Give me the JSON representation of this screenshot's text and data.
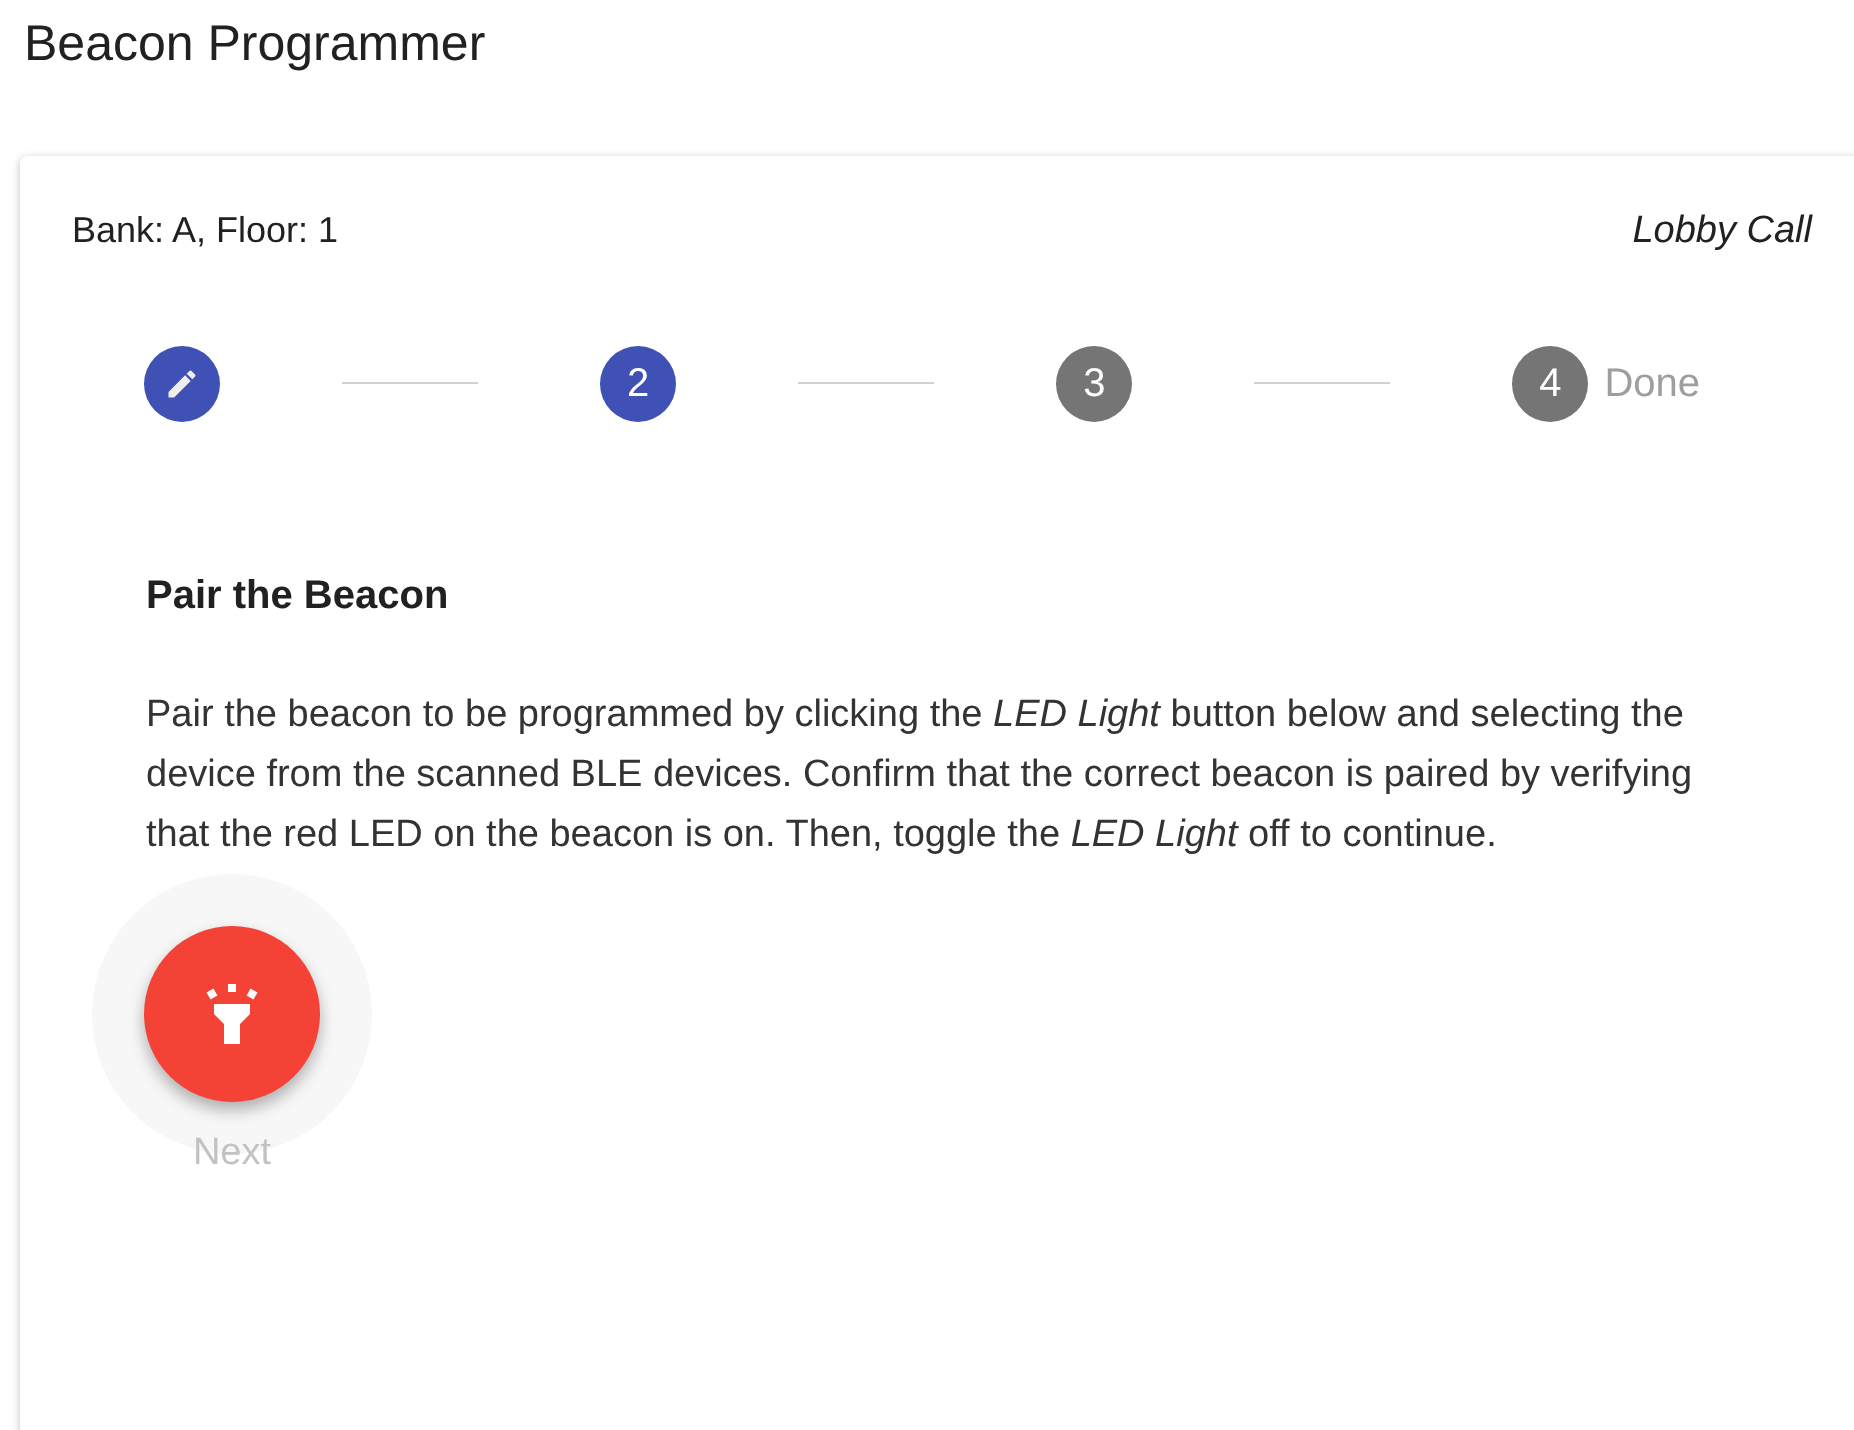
{
  "page_title": "Beacon Programmer",
  "card": {
    "location": "Bank: A, Floor: 1",
    "call_type": "Lobby Call",
    "steps": [
      {
        "completed": true,
        "selected": false
      },
      {
        "number": "2",
        "completed": false,
        "selected": true
      },
      {
        "number": "3",
        "completed": false,
        "selected": false
      },
      {
        "number": "4",
        "label": "Done",
        "completed": false,
        "selected": false
      }
    ],
    "heading": "Pair the Beacon",
    "body": "Pair the beacon to be programmed by clicking the *LED Light* button below and selecting the device from the scanned BLE devices. Confirm that the correct beacon is paired by verifying that the red LED on the beacon is on. Then, toggle the *LED Light* off to continue.",
    "next_button": {
      "label": "Next",
      "disabled": true
    }
  }
}
